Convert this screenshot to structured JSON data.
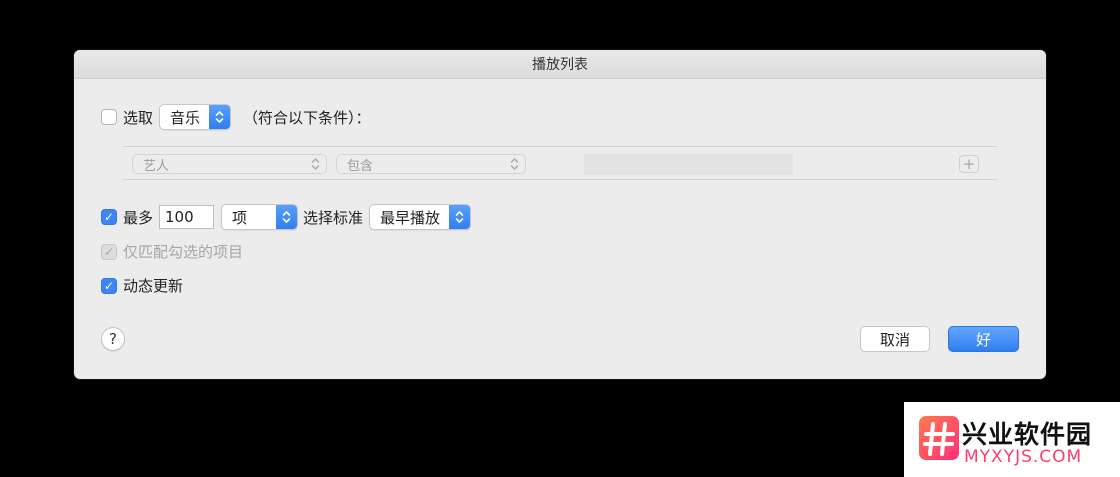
{
  "window": {
    "title": "播放列表"
  },
  "select_row": {
    "label": "选取",
    "checked": false,
    "media_popup": "音乐",
    "suffix": "（符合以下条件）："
  },
  "rule": {
    "field_popup": "艺人",
    "operator_popup": "包含",
    "value": "",
    "add_label": "+"
  },
  "limit_row": {
    "label": "最多",
    "checked": true,
    "count_value": "100",
    "unit_popup": "项",
    "criteria_label": "选择标准",
    "criteria_popup": "最早播放"
  },
  "match_checked": {
    "label": "仅匹配勾选的项目",
    "checked": true,
    "disabled": true
  },
  "live_update": {
    "label": "动态更新",
    "checked": true
  },
  "buttons": {
    "help": "?",
    "cancel": "取消",
    "ok": "好"
  },
  "colors": {
    "accent": "#3e86f5",
    "window_bg": "#ececec",
    "backdrop": "#000000"
  },
  "icons": {
    "check": "checkmark-icon",
    "popup_arrow": "up-down-chevron-icon"
  },
  "watermark": {
    "title": "兴业软件园",
    "subtitle": "MYXYJS.COM"
  }
}
